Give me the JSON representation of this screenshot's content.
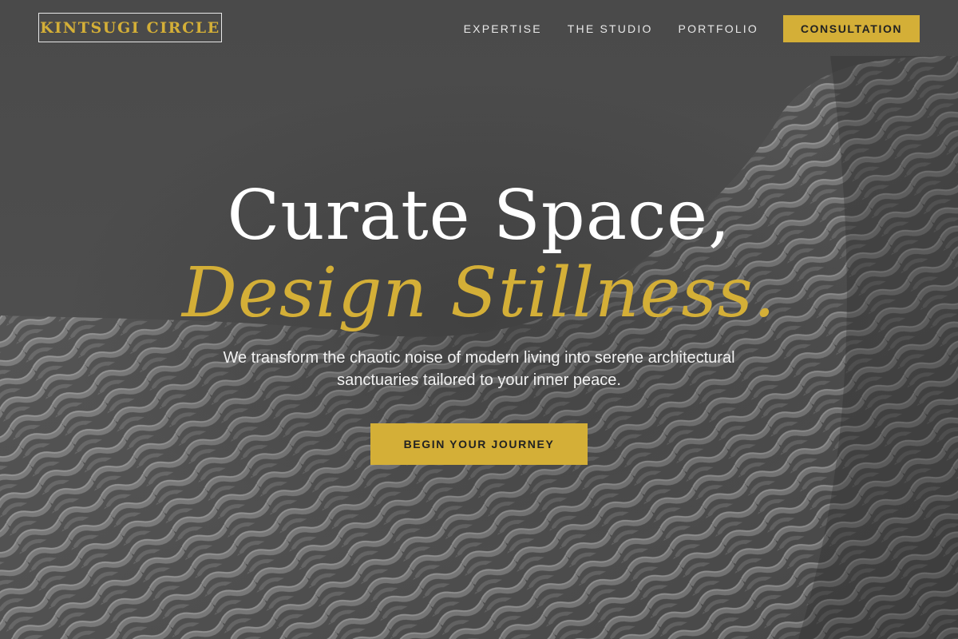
{
  "brand": {
    "name": "KINTSUGI CIRCLE",
    "accent_color": "#d4af37",
    "text_color": "#ffffff"
  },
  "nav": {
    "links": [
      "EXPERTISE",
      "THE STUDIO",
      "PORTFOLIO"
    ],
    "cta_label": "CONSULTATION"
  },
  "hero": {
    "headline_line1": "Curate Space,",
    "headline_line2": "Design Stillness.",
    "subtitle": "We transform the chaotic noise of modern living into serene architectural sanctuaries tailored to your inner peace.",
    "cta_label": "BEGIN YOUR JOURNEY",
    "background_image": "black-and-white woven architectural facade"
  }
}
